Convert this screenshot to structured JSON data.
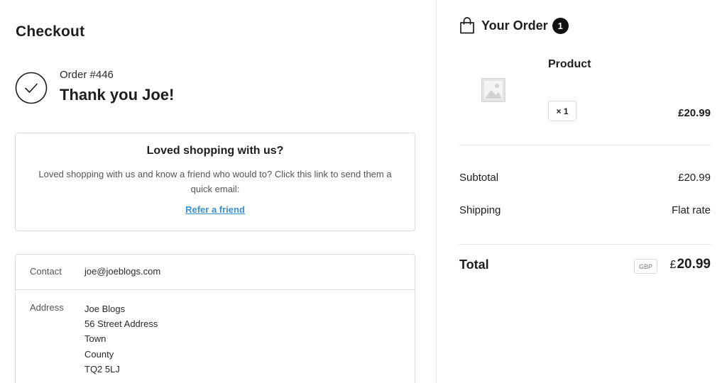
{
  "page_title": "Checkout",
  "confirmation": {
    "order_number": "Order #446",
    "thank_you": "Thank you Joe!"
  },
  "referral": {
    "title": "Loved shopping with us?",
    "text": "Loved shopping with us and know a friend who would to? Click this link to send them a quick email:",
    "link": "Refer a friend"
  },
  "details": {
    "contact_label": "Contact",
    "contact_value": "joe@joeblogs.com",
    "address_label": "Address",
    "address_lines": [
      "Joe Blogs",
      "56 Street Address",
      "Town",
      "County",
      "TQ2 5LJ"
    ]
  },
  "order": {
    "title": "Your Order",
    "count": "1",
    "product_header": "Product",
    "quantity": "× 1",
    "product_price": "£20.99",
    "subtotal_label": "Subtotal",
    "subtotal_value": "£20.99",
    "shipping_label": "Shipping",
    "shipping_value": "Flat rate",
    "total_label": "Total",
    "currency_code": "GBP",
    "total_symbol": "£",
    "total_amount": "20.99"
  },
  "colors": {
    "link": "#3b8fd0",
    "badge_bg": "#111111",
    "border": "#dcdcdc"
  },
  "icons": [
    "check-circle-icon",
    "shopping-bag-icon",
    "image-placeholder-icon"
  ]
}
